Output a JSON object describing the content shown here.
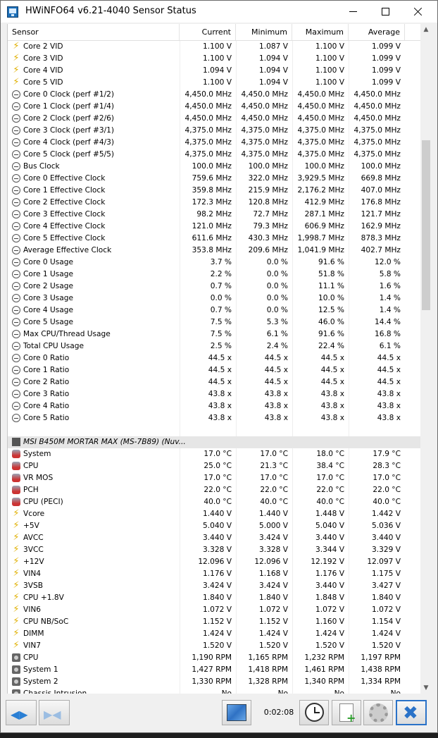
{
  "window": {
    "title": "HWiNFO64 v6.21-4040 Sensor Status"
  },
  "columns": [
    "Sensor",
    "Current",
    "Minimum",
    "Maximum",
    "Average"
  ],
  "rows": [
    {
      "icon": "bolt-icon",
      "name": "Core 2 VID",
      "cur": "1.100 V",
      "min": "1.087 V",
      "max": "1.100 V",
      "avg": "1.099 V"
    },
    {
      "icon": "bolt-icon",
      "name": "Core 3 VID",
      "cur": "1.100 V",
      "min": "1.094 V",
      "max": "1.100 V",
      "avg": "1.099 V"
    },
    {
      "icon": "bolt-icon",
      "name": "Core 4 VID",
      "cur": "1.094 V",
      "min": "1.094 V",
      "max": "1.100 V",
      "avg": "1.099 V"
    },
    {
      "icon": "bolt-icon",
      "name": "Core 5 VID",
      "cur": "1.100 V",
      "min": "1.094 V",
      "max": "1.100 V",
      "avg": "1.099 V"
    },
    {
      "icon": "clock-icon",
      "name": "Core 0 Clock (perf #1/2)",
      "cur": "4,450.0 MHz",
      "min": "4,450.0 MHz",
      "max": "4,450.0 MHz",
      "avg": "4,450.0 MHz"
    },
    {
      "icon": "clock-icon",
      "name": "Core 1 Clock (perf #1/4)",
      "cur": "4,450.0 MHz",
      "min": "4,450.0 MHz",
      "max": "4,450.0 MHz",
      "avg": "4,450.0 MHz"
    },
    {
      "icon": "clock-icon",
      "name": "Core 2 Clock (perf #2/6)",
      "cur": "4,450.0 MHz",
      "min": "4,450.0 MHz",
      "max": "4,450.0 MHz",
      "avg": "4,450.0 MHz"
    },
    {
      "icon": "clock-icon",
      "name": "Core 3 Clock (perf #3/1)",
      "cur": "4,375.0 MHz",
      "min": "4,375.0 MHz",
      "max": "4,375.0 MHz",
      "avg": "4,375.0 MHz"
    },
    {
      "icon": "clock-icon",
      "name": "Core 4 Clock (perf #4/3)",
      "cur": "4,375.0 MHz",
      "min": "4,375.0 MHz",
      "max": "4,375.0 MHz",
      "avg": "4,375.0 MHz"
    },
    {
      "icon": "clock-icon",
      "name": "Core 5 Clock (perf #5/5)",
      "cur": "4,375.0 MHz",
      "min": "4,375.0 MHz",
      "max": "4,375.0 MHz",
      "avg": "4,375.0 MHz"
    },
    {
      "icon": "clock-icon",
      "name": "Bus Clock",
      "cur": "100.0 MHz",
      "min": "100.0 MHz",
      "max": "100.0 MHz",
      "avg": "100.0 MHz"
    },
    {
      "icon": "clock-icon",
      "name": "Core 0 Effective Clock",
      "cur": "759.6 MHz",
      "min": "322.0 MHz",
      "max": "3,929.5 MHz",
      "avg": "669.8 MHz"
    },
    {
      "icon": "clock-icon",
      "name": "Core 1 Effective Clock",
      "cur": "359.8 MHz",
      "min": "215.9 MHz",
      "max": "2,176.2 MHz",
      "avg": "407.0 MHz"
    },
    {
      "icon": "clock-icon",
      "name": "Core 2 Effective Clock",
      "cur": "172.3 MHz",
      "min": "120.8 MHz",
      "max": "412.9 MHz",
      "avg": "176.8 MHz"
    },
    {
      "icon": "clock-icon",
      "name": "Core 3 Effective Clock",
      "cur": "98.2 MHz",
      "min": "72.7 MHz",
      "max": "287.1 MHz",
      "avg": "121.7 MHz"
    },
    {
      "icon": "clock-icon",
      "name": "Core 4 Effective Clock",
      "cur": "121.0 MHz",
      "min": "79.3 MHz",
      "max": "606.9 MHz",
      "avg": "162.9 MHz"
    },
    {
      "icon": "clock-icon",
      "name": "Core 5 Effective Clock",
      "cur": "611.6 MHz",
      "min": "430.3 MHz",
      "max": "1,998.7 MHz",
      "avg": "878.3 MHz"
    },
    {
      "icon": "clock-icon",
      "name": "Average Effective Clock",
      "cur": "353.8 MHz",
      "min": "209.6 MHz",
      "max": "1,041.9 MHz",
      "avg": "402.7 MHz"
    },
    {
      "icon": "clock-icon",
      "name": "Core 0 Usage",
      "cur": "3.7 %",
      "min": "0.0 %",
      "max": "91.6 %",
      "avg": "12.0 %"
    },
    {
      "icon": "clock-icon",
      "name": "Core 1 Usage",
      "cur": "2.2 %",
      "min": "0.0 %",
      "max": "51.8 %",
      "avg": "5.8 %"
    },
    {
      "icon": "clock-icon",
      "name": "Core 2 Usage",
      "cur": "0.7 %",
      "min": "0.0 %",
      "max": "11.1 %",
      "avg": "1.6 %"
    },
    {
      "icon": "clock-icon",
      "name": "Core 3 Usage",
      "cur": "0.0 %",
      "min": "0.0 %",
      "max": "10.0 %",
      "avg": "1.4 %"
    },
    {
      "icon": "clock-icon",
      "name": "Core 4 Usage",
      "cur": "0.7 %",
      "min": "0.0 %",
      "max": "12.5 %",
      "avg": "1.4 %"
    },
    {
      "icon": "clock-icon",
      "name": "Core 5 Usage",
      "cur": "7.5 %",
      "min": "5.3 %",
      "max": "46.0 %",
      "avg": "14.4 %"
    },
    {
      "icon": "clock-icon",
      "name": "Max CPU/Thread Usage",
      "cur": "7.5 %",
      "min": "6.1 %",
      "max": "91.6 %",
      "avg": "16.8 %"
    },
    {
      "icon": "clock-icon",
      "name": "Total CPU Usage",
      "cur": "2.5 %",
      "min": "2.4 %",
      "max": "22.4 %",
      "avg": "6.1 %"
    },
    {
      "icon": "clock-icon",
      "name": "Core 0 Ratio",
      "cur": "44.5 x",
      "min": "44.5 x",
      "max": "44.5 x",
      "avg": "44.5 x"
    },
    {
      "icon": "clock-icon",
      "name": "Core 1 Ratio",
      "cur": "44.5 x",
      "min": "44.5 x",
      "max": "44.5 x",
      "avg": "44.5 x"
    },
    {
      "icon": "clock-icon",
      "name": "Core 2 Ratio",
      "cur": "44.5 x",
      "min": "44.5 x",
      "max": "44.5 x",
      "avg": "44.5 x"
    },
    {
      "icon": "clock-icon",
      "name": "Core 3 Ratio",
      "cur": "43.8 x",
      "min": "43.8 x",
      "max": "43.8 x",
      "avg": "43.8 x"
    },
    {
      "icon": "clock-icon",
      "name": "Core 4 Ratio",
      "cur": "43.8 x",
      "min": "43.8 x",
      "max": "43.8 x",
      "avg": "43.8 x"
    },
    {
      "icon": "clock-icon",
      "name": "Core 5 Ratio",
      "cur": "43.8 x",
      "min": "43.8 x",
      "max": "43.8 x",
      "avg": "43.8 x"
    },
    {
      "icon": "",
      "name": "",
      "cur": "",
      "min": "",
      "max": "",
      "avg": ""
    },
    {
      "icon": "chip-icon",
      "name": "MSI B450M MORTAR MAX (MS-7B89) (Nuv...",
      "cur": "",
      "min": "",
      "max": "",
      "avg": "",
      "group": true
    },
    {
      "icon": "thermometer-icon",
      "name": "System",
      "cur": "17.0 °C",
      "min": "17.0 °C",
      "max": "18.0 °C",
      "avg": "17.9 °C"
    },
    {
      "icon": "thermometer-icon",
      "name": "CPU",
      "cur": "25.0 °C",
      "min": "21.3 °C",
      "max": "38.4 °C",
      "avg": "28.3 °C"
    },
    {
      "icon": "thermometer-icon",
      "name": "VR MOS",
      "cur": "17.0 °C",
      "min": "17.0 °C",
      "max": "17.0 °C",
      "avg": "17.0 °C"
    },
    {
      "icon": "thermometer-icon",
      "name": "PCH",
      "cur": "22.0 °C",
      "min": "22.0 °C",
      "max": "22.0 °C",
      "avg": "22.0 °C"
    },
    {
      "icon": "thermometer-icon",
      "name": "CPU (PECI)",
      "cur": "40.0 °C",
      "min": "40.0 °C",
      "max": "40.0 °C",
      "avg": "40.0 °C"
    },
    {
      "icon": "bolt-icon",
      "name": "Vcore",
      "cur": "1.440 V",
      "min": "1.440 V",
      "max": "1.448 V",
      "avg": "1.442 V"
    },
    {
      "icon": "bolt-icon",
      "name": "+5V",
      "cur": "5.040 V",
      "min": "5.000 V",
      "max": "5.040 V",
      "avg": "5.036 V"
    },
    {
      "icon": "bolt-icon",
      "name": "AVCC",
      "cur": "3.440 V",
      "min": "3.424 V",
      "max": "3.440 V",
      "avg": "3.440 V"
    },
    {
      "icon": "bolt-icon",
      "name": "3VCC",
      "cur": "3.328 V",
      "min": "3.328 V",
      "max": "3.344 V",
      "avg": "3.329 V"
    },
    {
      "icon": "bolt-icon",
      "name": "+12V",
      "cur": "12.096 V",
      "min": "12.096 V",
      "max": "12.192 V",
      "avg": "12.097 V"
    },
    {
      "icon": "bolt-icon",
      "name": "VIN4",
      "cur": "1.176 V",
      "min": "1.168 V",
      "max": "1.176 V",
      "avg": "1.175 V"
    },
    {
      "icon": "bolt-icon",
      "name": "3VSB",
      "cur": "3.424 V",
      "min": "3.424 V",
      "max": "3.440 V",
      "avg": "3.427 V"
    },
    {
      "icon": "bolt-icon",
      "name": "CPU +1.8V",
      "cur": "1.840 V",
      "min": "1.840 V",
      "max": "1.848 V",
      "avg": "1.840 V"
    },
    {
      "icon": "bolt-icon",
      "name": "VIN6",
      "cur": "1.072 V",
      "min": "1.072 V",
      "max": "1.072 V",
      "avg": "1.072 V"
    },
    {
      "icon": "bolt-icon",
      "name": "CPU NB/SoC",
      "cur": "1.152 V",
      "min": "1.152 V",
      "max": "1.160 V",
      "avg": "1.154 V"
    },
    {
      "icon": "bolt-icon",
      "name": "DIMM",
      "cur": "1.424 V",
      "min": "1.424 V",
      "max": "1.424 V",
      "avg": "1.424 V"
    },
    {
      "icon": "bolt-icon",
      "name": "VIN7",
      "cur": "1.520 V",
      "min": "1.520 V",
      "max": "1.520 V",
      "avg": "1.520 V"
    },
    {
      "icon": "fan-icon",
      "name": "CPU",
      "cur": "1,190 RPM",
      "min": "1,165 RPM",
      "max": "1,232 RPM",
      "avg": "1,197 RPM"
    },
    {
      "icon": "fan-icon",
      "name": "System 1",
      "cur": "1,427 RPM",
      "min": "1,418 RPM",
      "max": "1,461 RPM",
      "avg": "1,438 RPM"
    },
    {
      "icon": "fan-icon",
      "name": "System 2",
      "cur": "1,330 RPM",
      "min": "1,328 RPM",
      "max": "1,340 RPM",
      "avg": "1,334 RPM"
    },
    {
      "icon": "shield-icon",
      "name": "Chassis Intrusion",
      "cur": "No",
      "min": "No",
      "max": "No",
      "avg": "No"
    }
  ],
  "toolbar": {
    "timer": "0:02:08"
  },
  "scrollbar": {
    "position": 0.22
  }
}
